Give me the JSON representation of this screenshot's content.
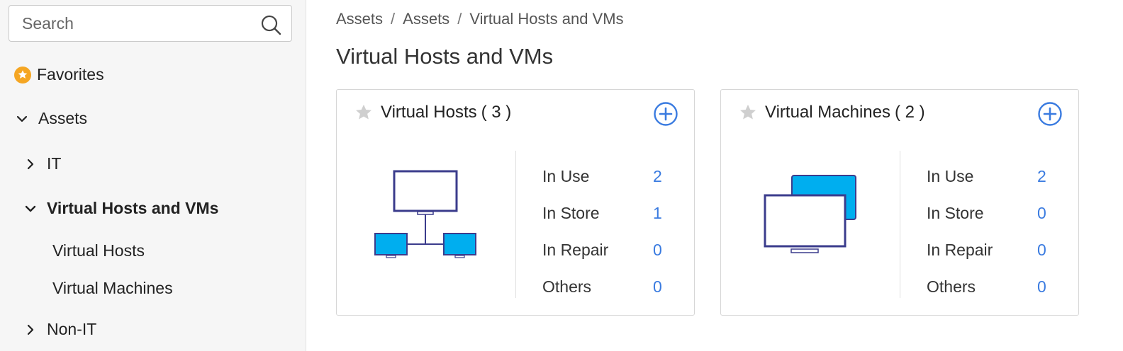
{
  "sidebar": {
    "search_placeholder": "Search",
    "favorites": "Favorites",
    "assets": "Assets",
    "it": "IT",
    "virtual_hosts_and_vms": "Virtual Hosts and VMs",
    "virtual_hosts": "Virtual Hosts",
    "virtual_machines": "Virtual Machines",
    "non_it": "Non-IT"
  },
  "breadcrumb": [
    "Assets",
    "Assets",
    "Virtual Hosts and VMs"
  ],
  "page_title": "Virtual Hosts and VMs",
  "cards": [
    {
      "title": "Virtual Hosts",
      "count": "( 3 )",
      "stats": [
        {
          "label": "In Use",
          "value": "2"
        },
        {
          "label": "In Store",
          "value": "1"
        },
        {
          "label": "In Repair",
          "value": "0"
        },
        {
          "label": "Others",
          "value": "0"
        }
      ]
    },
    {
      "title": "Virtual Machines",
      "count": "( 2 )",
      "stats": [
        {
          "label": "In Use",
          "value": "2"
        },
        {
          "label": "In Store",
          "value": "0"
        },
        {
          "label": "In Repair",
          "value": "0"
        },
        {
          "label": "Others",
          "value": "0"
        }
      ]
    }
  ],
  "colors": {
    "accent_blue": "#3a7be0",
    "monitor_outline": "#3b3c8c",
    "monitor_fill": "#00aeef",
    "favorite_star": "#f5a623"
  }
}
